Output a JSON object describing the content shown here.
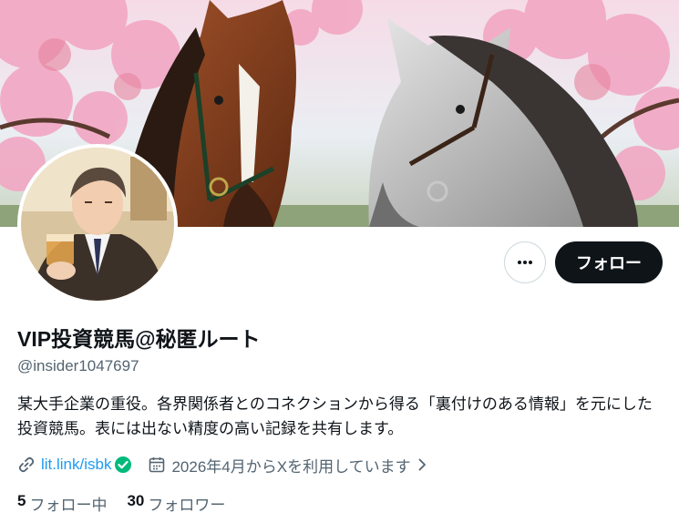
{
  "profile": {
    "display_name": "VIP投資競馬@秘匿ルート",
    "handle": "@insider1047697",
    "bio": "某大手企業の重役。各界関係者とのコネクションから得る「裏付けのある情報」を元にした投資競馬。表には出ない精度の高い記録を共有します。",
    "link": "lit.link/isbk",
    "joined": "2026年4月からXを利用しています"
  },
  "actions": {
    "follow_label": "フォロー",
    "more_icon": "ellipsis-icon"
  },
  "stats": {
    "following_count": "5",
    "following_label": "フォロー中",
    "followers_count": "30",
    "followers_label": "フォロワー"
  },
  "icons": {
    "link": "link-icon",
    "verified": "verified-badge-icon",
    "calendar": "calendar-icon",
    "chevron": "chevron-right-icon"
  },
  "colors": {
    "accent": "#1d9bf0",
    "verified": "#00ba7c",
    "text": "#0f1419",
    "muted": "#536471",
    "button": "#0f1419"
  }
}
